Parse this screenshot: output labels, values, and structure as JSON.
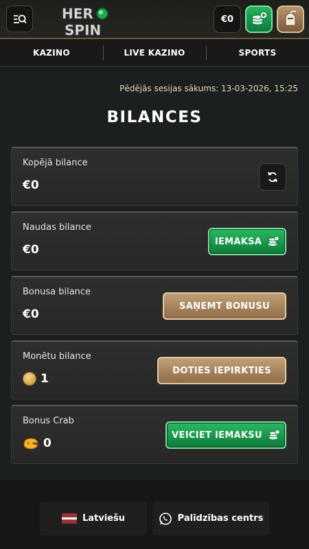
{
  "header": {
    "wallet_label": "€0"
  },
  "nav": {
    "items": [
      {
        "label": "KAZINO"
      },
      {
        "label": "LIVE KAZINO"
      },
      {
        "label": "SPORTS"
      }
    ]
  },
  "session": {
    "text": "Pēdējās sesijas sākums: 13-03-2026, 15:25"
  },
  "page": {
    "title": "BILANCES"
  },
  "cards": [
    {
      "label": "Kopējā bilance",
      "value": "€0"
    },
    {
      "label": "Naudas bilance",
      "value": "€0",
      "button": "IEMAKSA"
    },
    {
      "label": "Bonusa bilance",
      "value": "€0",
      "button": "SAŅEMT BONUSU"
    },
    {
      "label": "Monētu bilance",
      "value": "1",
      "button": "DOTIES IEPIRKTIES"
    },
    {
      "label": "Bonus Crab",
      "value": "0",
      "button": "VEICIET IEMAKSU"
    }
  ],
  "footer": {
    "language": "Latviešu",
    "help": "Palīdzības centrs"
  },
  "colors": {
    "green_button": "#1a9a4d",
    "gold_button": "#a8855c",
    "background": "#1c1f1f"
  }
}
